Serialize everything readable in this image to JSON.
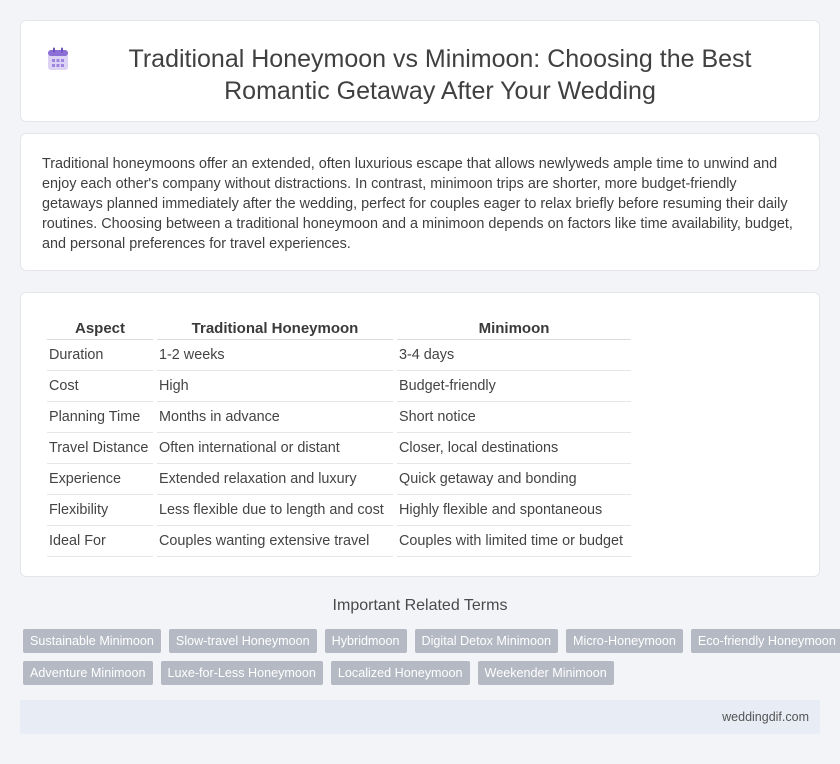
{
  "header": {
    "title": "Traditional Honeymoon vs Minimoon: Choosing the Best Romantic Getaway After Your Wedding",
    "icon": "calendar-icon"
  },
  "intro": {
    "text": "Traditional honeymoons offer an extended, often luxurious escape that allows newlyweds ample time to unwind and enjoy each other's company without distractions. In contrast, minimoon trips are shorter, more budget-friendly getaways planned immediately after the wedding, perfect for couples eager to relax briefly before resuming their daily routines. Choosing between a traditional honeymoon and a minimoon depends on factors like time availability, budget, and personal preferences for travel experiences."
  },
  "table": {
    "headers": [
      "Aspect",
      "Traditional Honeymoon",
      "Minimoon"
    ],
    "rows": [
      [
        "Duration",
        "1-2 weeks",
        "3-4 days"
      ],
      [
        "Cost",
        "High",
        "Budget-friendly"
      ],
      [
        "Planning Time",
        "Months in advance",
        "Short notice"
      ],
      [
        "Travel Distance",
        "Often international or distant",
        "Closer, local destinations"
      ],
      [
        "Experience",
        "Extended relaxation and luxury",
        "Quick getaway and bonding"
      ],
      [
        "Flexibility",
        "Less flexible due to length and cost",
        "Highly flexible and spontaneous"
      ],
      [
        "Ideal For",
        "Couples wanting extensive travel",
        "Couples with limited time or budget"
      ]
    ]
  },
  "related": {
    "heading": "Important Related Terms",
    "row1": [
      "Sustainable Minimoon",
      "Slow-travel Honeymoon",
      "Hybridmoon",
      "Digital Detox Minimoon",
      "Micro-Honeymoon",
      "Eco-friendly Honeymoon"
    ],
    "row2": [
      "Adventure Minimoon",
      "Luxe-for-Less Honeymoon",
      "Localized Honeymoon",
      "Weekender Minimoon"
    ]
  },
  "footer": {
    "site": "weddingdif.com"
  },
  "colors": {
    "tag_bg": "#b4b9c3",
    "footer_bg": "#e8ecf5",
    "icon_purple": "#8c6fd6"
  }
}
